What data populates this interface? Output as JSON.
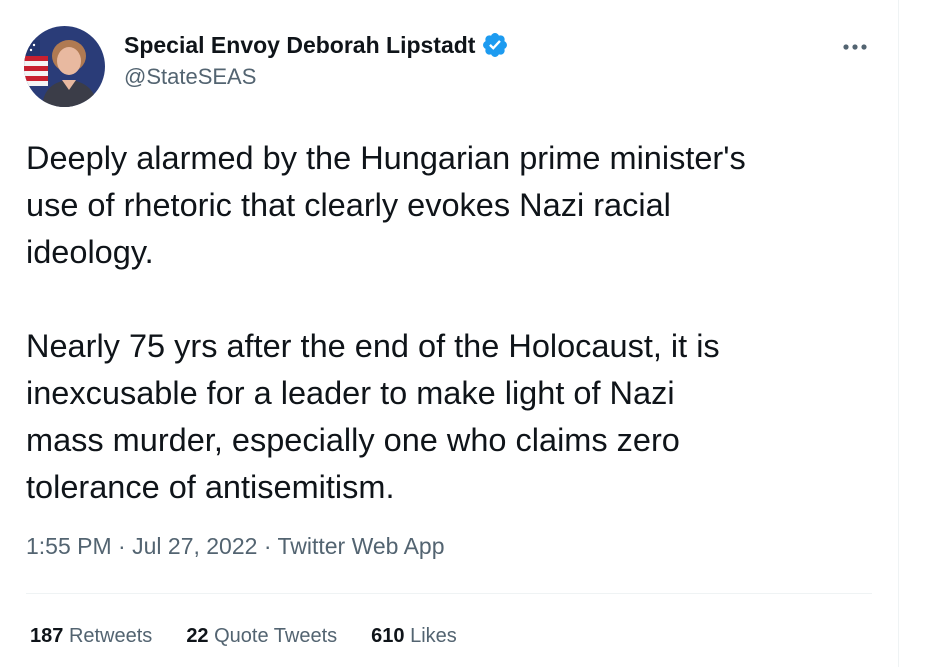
{
  "author": {
    "display_name": "Special Envoy Deborah Lipstadt",
    "handle": "@StateSEAS",
    "verified": true
  },
  "tweet": {
    "paragraph1": [
      "Deeply alarmed by the Hungarian prime minister's",
      "use of rhetoric that clearly evokes Nazi racial",
      "ideology."
    ],
    "paragraph2": [
      "Nearly 75 yrs after the end of the Holocaust, it is",
      "inexcusable for a leader to make light of Nazi",
      "mass murder, especially one who claims zero",
      "tolerance of antisemitism."
    ]
  },
  "meta": {
    "time": "1:55 PM",
    "date": "Jul 27, 2022",
    "source": "Twitter Web App",
    "separator": "·"
  },
  "stats": [
    {
      "count": "187",
      "label": "Retweets"
    },
    {
      "count": "22",
      "label": "Quote Tweets"
    },
    {
      "count": "610",
      "label": "Likes"
    }
  ],
  "icons": {
    "verified": "verified-badge-icon",
    "more": "more-options-icon"
  },
  "colors": {
    "verified_blue": "#1d9bf0",
    "text_primary": "#0f1419",
    "text_secondary": "#536471"
  }
}
